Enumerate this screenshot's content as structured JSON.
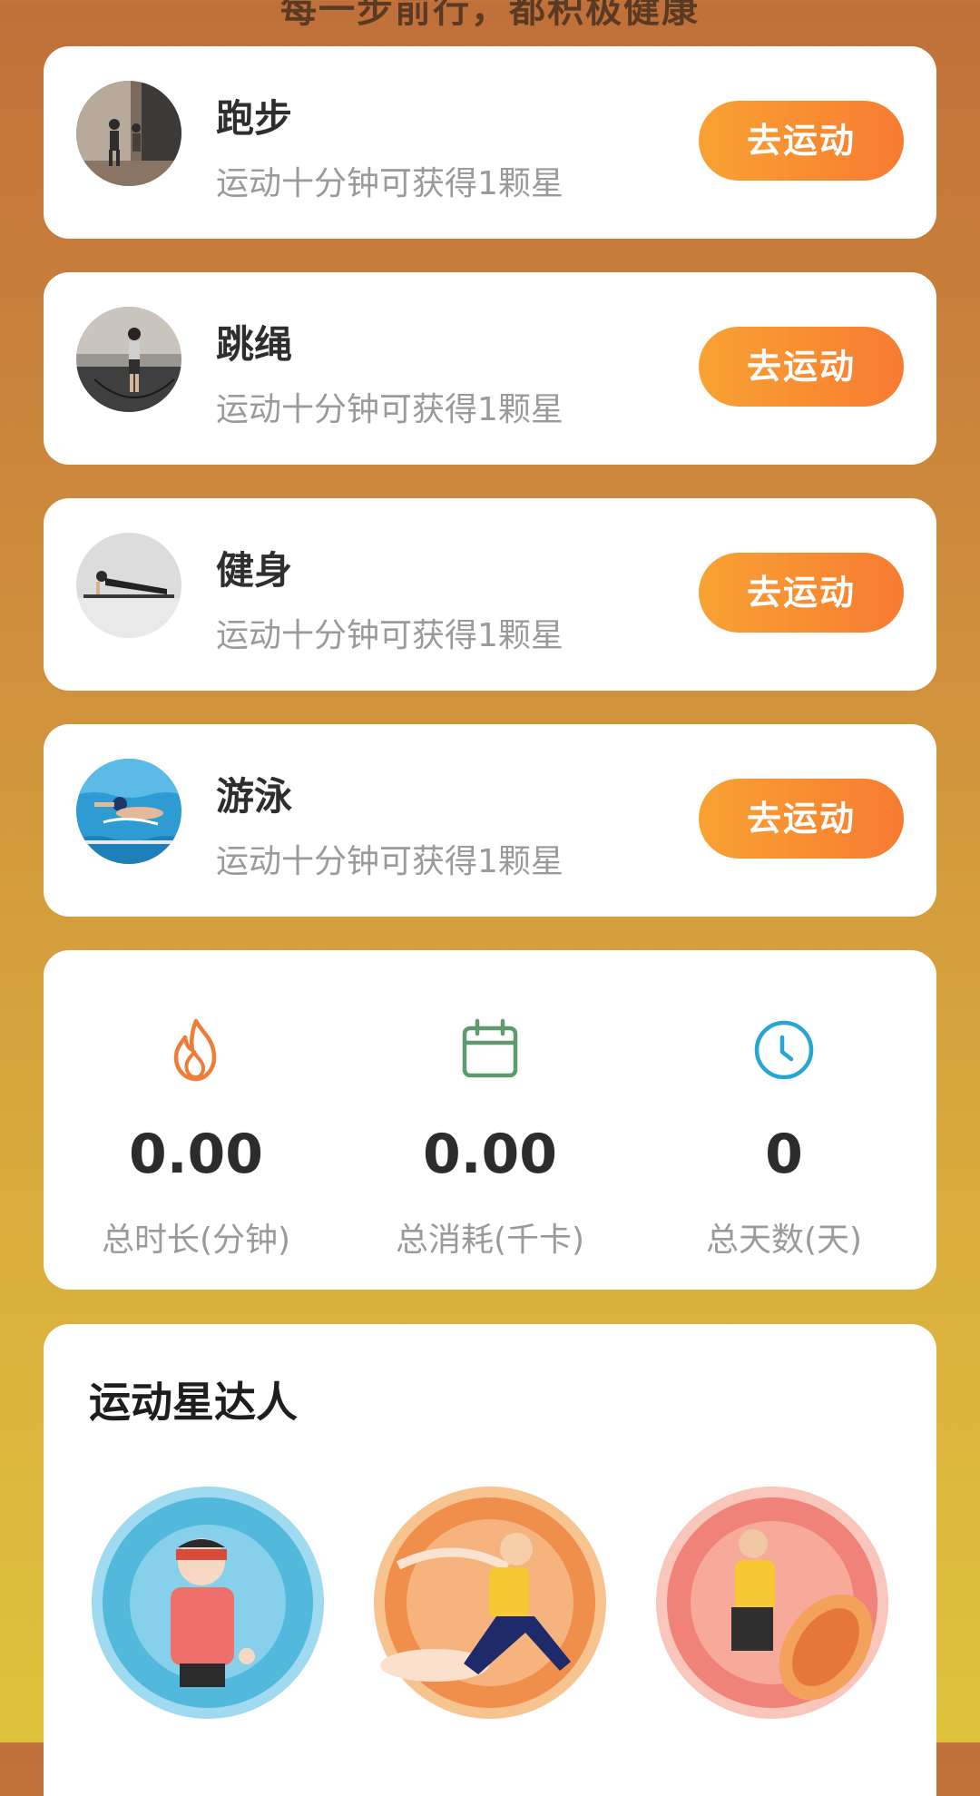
{
  "header": {
    "slogan": "每一步前行，都积极健康"
  },
  "sports": [
    {
      "name": "跑步",
      "desc": "运动十分钟可获得1颗星",
      "button": "去运动",
      "photo_icon": "running-photo"
    },
    {
      "name": "跳绳",
      "desc": "运动十分钟可获得1颗星",
      "button": "去运动",
      "photo_icon": "jump-rope-photo"
    },
    {
      "name": "健身",
      "desc": "运动十分钟可获得1颗星",
      "button": "去运动",
      "photo_icon": "fitness-photo"
    },
    {
      "name": "游泳",
      "desc": "运动十分钟可获得1颗星",
      "button": "去运动",
      "photo_icon": "swimming-photo"
    }
  ],
  "stats": [
    {
      "icon": "flame-icon",
      "color": "#ee7d3a",
      "value": "0.00",
      "label": "总时长(分钟)"
    },
    {
      "icon": "calendar-icon",
      "color": "#5e9a6e",
      "value": "0.00",
      "label": "总消耗(千卡)"
    },
    {
      "icon": "clock-icon",
      "color": "#27a6d6",
      "value": "0",
      "label": "总天数(天)"
    }
  ],
  "star_section": {
    "title": "运动星达人",
    "badges": [
      {
        "icon": "blue-runner-badge",
        "color": "#52b8dc"
      },
      {
        "icon": "orange-leaper-badge",
        "color": "#f08f4c"
      },
      {
        "icon": "pink-kicker-badge",
        "color": "#f0827a"
      }
    ]
  },
  "colors": {
    "button_gradient_start": "#f9a233",
    "button_gradient_end": "#f77b32",
    "background_top": "#c0703a",
    "background_bottom": "#dfc23c"
  }
}
